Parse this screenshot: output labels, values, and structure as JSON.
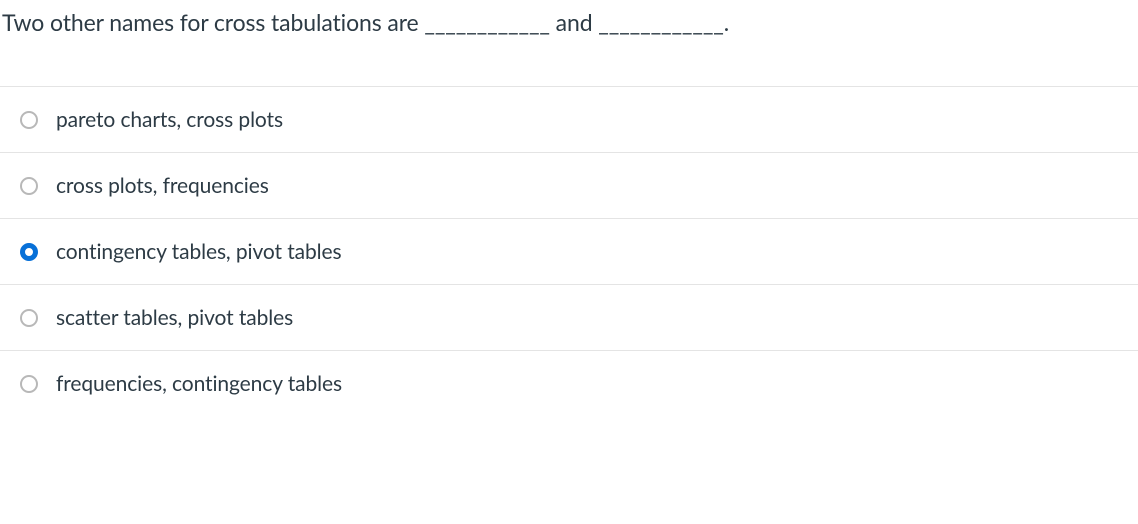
{
  "question": {
    "text": "Two other names for cross tabulations are ____________ and ____________."
  },
  "options": [
    {
      "label": "pareto charts, cross plots",
      "selected": false
    },
    {
      "label": "cross plots, frequencies",
      "selected": false
    },
    {
      "label": "contingency tables, pivot tables",
      "selected": true
    },
    {
      "label": "scatter tables, pivot tables",
      "selected": false
    },
    {
      "label": "frequencies, contingency tables",
      "selected": false
    }
  ]
}
